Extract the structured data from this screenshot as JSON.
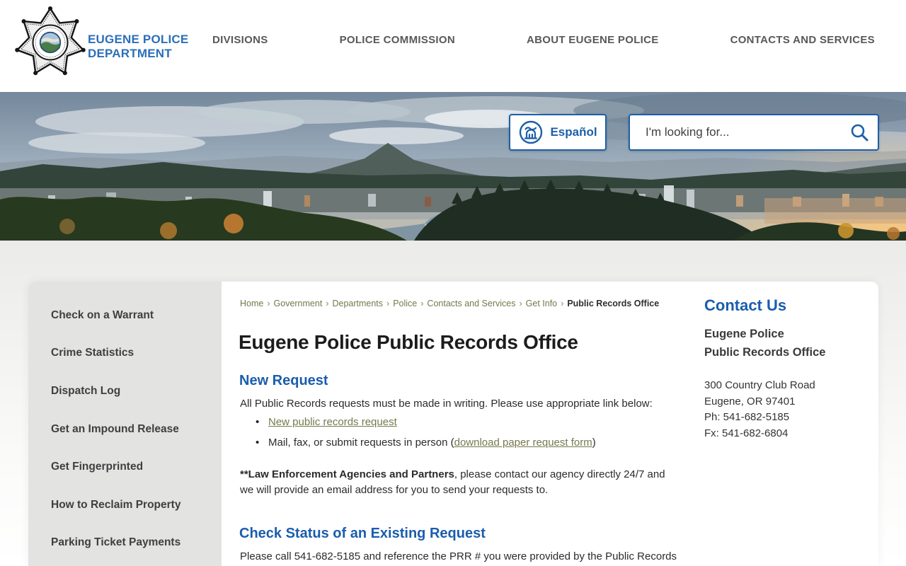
{
  "header": {
    "site_name_line1": "EUGENE POLICE",
    "site_name_line2": "DEPARTMENT",
    "nav": [
      {
        "label": "DIVISIONS"
      },
      {
        "label": "POLICE COMMISSION"
      },
      {
        "label": "ABOUT EUGENE POLICE"
      },
      {
        "label": "CONTACTS AND SERVICES"
      }
    ]
  },
  "hero": {
    "espanol_label": "Español",
    "search_placeholder": "I'm looking for..."
  },
  "icons": {
    "logo": "eugene-police-seven-point-badge",
    "espanol_icon": "translate-building-with-tilde-in-circle",
    "search_icon": "magnifying-glass"
  },
  "sidebar": {
    "items": [
      {
        "label": "Check on a Warrant"
      },
      {
        "label": "Crime Statistics"
      },
      {
        "label": "Dispatch Log"
      },
      {
        "label": "Get an Impound Release"
      },
      {
        "label": "Get Fingerprinted"
      },
      {
        "label": "How to Reclaim Property"
      },
      {
        "label": "Parking Ticket Payments"
      }
    ]
  },
  "breadcrumb": {
    "separator": "›",
    "links": [
      "Home",
      "Government",
      "Departments",
      "Police",
      "Contacts and Services",
      "Get Info"
    ],
    "current": "Public Records Office"
  },
  "main": {
    "title": "Eugene Police Public Records Office",
    "new_request": {
      "heading": "New Request",
      "intro": "All Public Records  requests must be made in writing. Please use appropriate link below:",
      "bullet1_link": "New public records request",
      "bullet2_prefix": "Mail, fax, or submit requests in person (",
      "bullet2_link": "download paper request form",
      "bullet2_suffix": ")",
      "note_bold": "**Law Enforcement Agencies and Partners",
      "note_rest": ", please contact our agency directly 24/7 and we will provide an email address for you to send your requests to."
    },
    "check_status": {
      "heading": "Check Status of an Existing Request",
      "body": "Please call 541-682-5185 and reference the PRR # you were provided by the Public Records"
    }
  },
  "contact": {
    "heading": "Contact Us",
    "org_line1": "Eugene Police",
    "org_line2": "Public Records Office",
    "address_line1": "300 Country Club Road",
    "address_line2": "Eugene, OR 97401",
    "phone": "Ph: 541-682-5185",
    "fax": "Fx: 541-682-6804"
  },
  "colors": {
    "accent_blue": "#1a5dad",
    "control_border_blue": "#1d5fa8",
    "site_title_blue": "#2b6fb8",
    "nav_gray": "#58585a",
    "olive_link": "#75794c",
    "sidebar_bg": "#e3e3e1",
    "body_text": "#2b2b2b"
  }
}
